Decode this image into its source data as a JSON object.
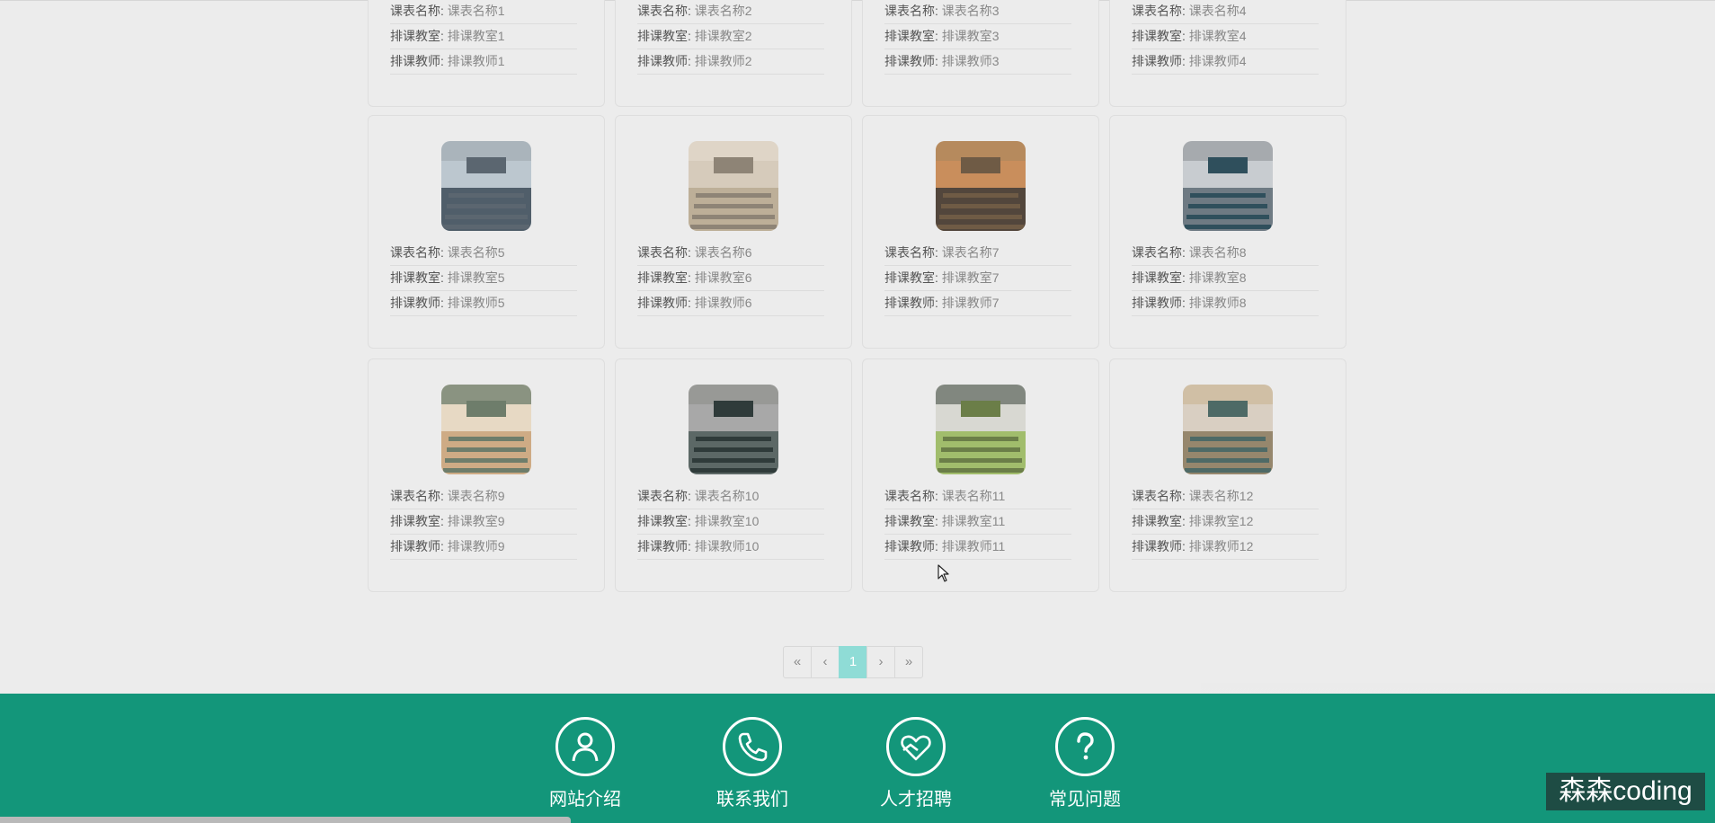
{
  "labels": {
    "course_name": "课表名称:",
    "classroom": "排课教室:",
    "teacher": "排课教师:"
  },
  "cards": [
    {
      "course_name": "课表名称1",
      "classroom": "排课教室1",
      "teacher": "排课教师1"
    },
    {
      "course_name": "课表名称2",
      "classroom": "排课教室2",
      "teacher": "排课教师2"
    },
    {
      "course_name": "课表名称3",
      "classroom": "排课教室3",
      "teacher": "排课教师3"
    },
    {
      "course_name": "课表名称4",
      "classroom": "排课教室4",
      "teacher": "排课教师4"
    },
    {
      "course_name": "课表名称5",
      "classroom": "排课教室5",
      "teacher": "排课教师5"
    },
    {
      "course_name": "课表名称6",
      "classroom": "排课教室6",
      "teacher": "排课教师6"
    },
    {
      "course_name": "课表名称7",
      "classroom": "排课教室7",
      "teacher": "排课教师7"
    },
    {
      "course_name": "课表名称8",
      "classroom": "排课教室8",
      "teacher": "排课教师8"
    },
    {
      "course_name": "课表名称9",
      "classroom": "排课教室9",
      "teacher": "排课教师9"
    },
    {
      "course_name": "课表名称10",
      "classroom": "排课教室10",
      "teacher": "排课教师10"
    },
    {
      "course_name": "课表名称11",
      "classroom": "排课教室11",
      "teacher": "排课教师11"
    },
    {
      "course_name": "课表名称12",
      "classroom": "排课教室12",
      "teacher": "排课教师12"
    }
  ],
  "pagination": {
    "first": "«",
    "prev": "‹",
    "current": "1",
    "next": "›",
    "last": "»"
  },
  "footer": {
    "items": [
      {
        "label": "网站介绍",
        "icon": "person-icon"
      },
      {
        "label": "联系我们",
        "icon": "phone-icon"
      },
      {
        "label": "人才招聘",
        "icon": "heart-hands-icon"
      },
      {
        "label": "常见问题",
        "icon": "question-icon"
      }
    ]
  },
  "watermark": "森森coding",
  "colors": {
    "background": "#ececec",
    "footer": "#13967a",
    "active_page": "#8fdcd6",
    "watermark_bg": "#1e4c44"
  }
}
